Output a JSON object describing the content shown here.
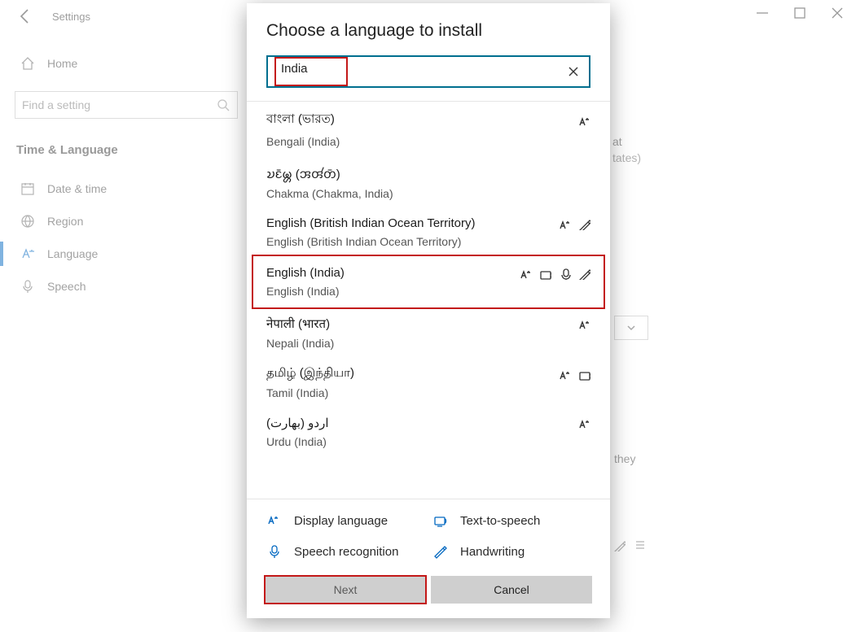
{
  "titlebar": {
    "app_title": "Settings"
  },
  "sidebar": {
    "home_label": "Home",
    "search_placeholder": "Find a setting",
    "group_label": "Time & Language",
    "items": [
      {
        "label": "Date & time"
      },
      {
        "label": "Region"
      },
      {
        "label": "Language"
      },
      {
        "label": "Speech"
      }
    ]
  },
  "background_fragments": {
    "format_fragment": "at",
    "states_fragment": "tates)",
    "they_fragment": "they"
  },
  "dialog": {
    "title": "Choose a language to install",
    "search_value": "India",
    "languages": [
      {
        "native": "বাংলা (ভারত)",
        "english": "Bengali (India)",
        "features": [
          "display"
        ]
      },
      {
        "native": "𑄌𑄋𑄴𑄟𑄳𑄦 (𑄞𑄢𑄧𑄖𑄴)",
        "english": "Chakma (Chakma, India)",
        "features": []
      },
      {
        "native": "English (British Indian Ocean Territory)",
        "english": "English (British Indian Ocean Territory)",
        "features": [
          "display",
          "handwriting"
        ]
      },
      {
        "native": "English (India)",
        "english": "English (India)",
        "features": [
          "display",
          "tts",
          "speech",
          "handwriting"
        ]
      },
      {
        "native": "नेपाली (भारत)",
        "english": "Nepali (India)",
        "features": [
          "display"
        ]
      },
      {
        "native": "தமிழ் (இந்தியா)",
        "english": "Tamil (India)",
        "features": [
          "display",
          "tts"
        ]
      },
      {
        "native": "اردو (بھارت)",
        "english": "Urdu (India)",
        "features": [
          "display"
        ]
      }
    ],
    "legend": {
      "display": "Display language",
      "tts": "Text-to-speech",
      "speech": "Speech recognition",
      "handwriting": "Handwriting"
    },
    "buttons": {
      "next": "Next",
      "cancel": "Cancel"
    }
  }
}
